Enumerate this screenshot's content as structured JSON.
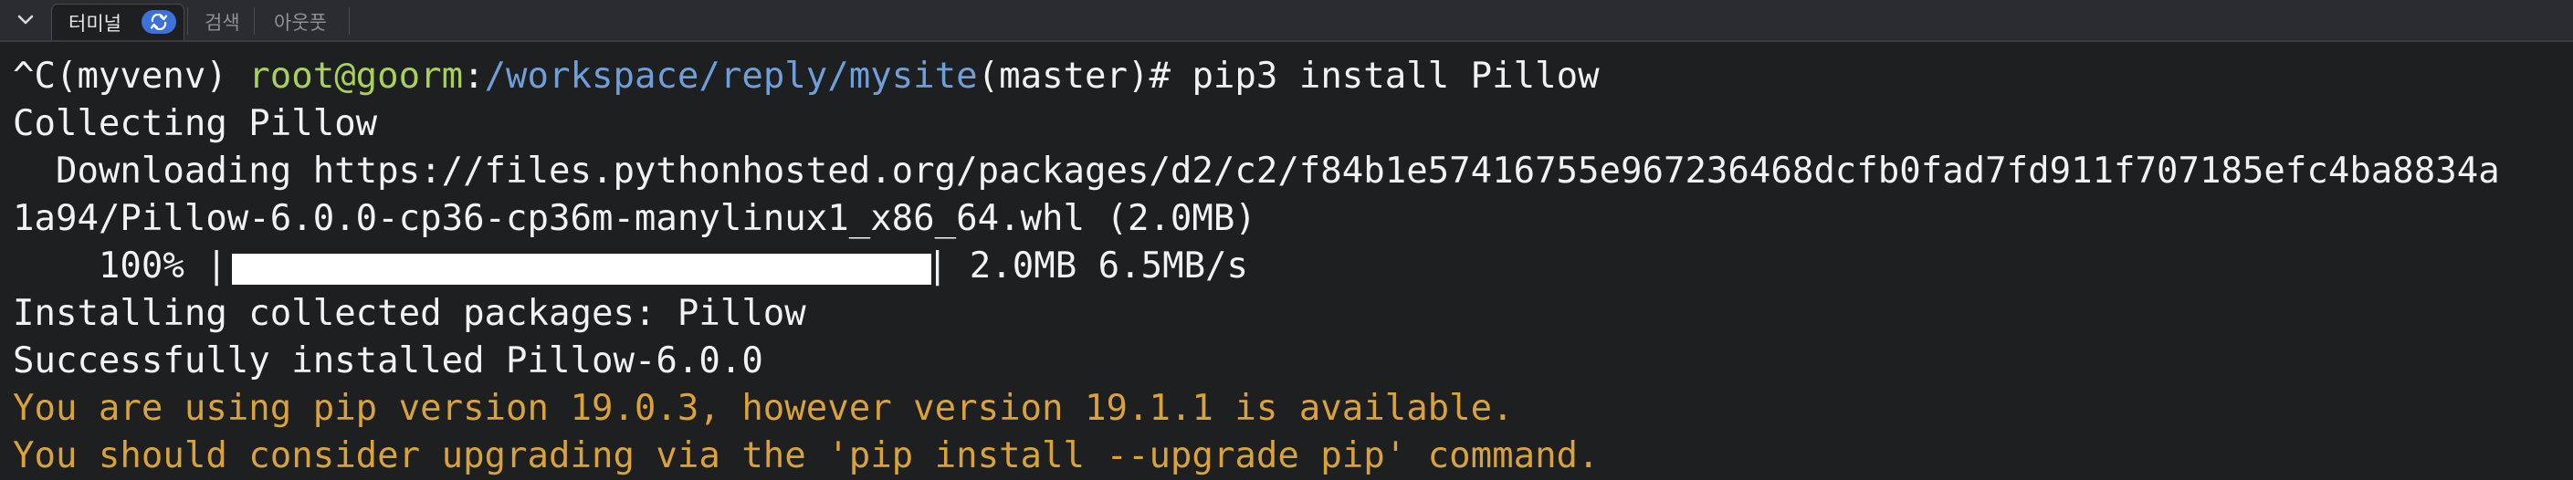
{
  "tabs": {
    "terminal": "터미널",
    "search": "검색",
    "outline": "아웃풋"
  },
  "icons": {
    "collapse": "chevron-down-icon",
    "sync": "sync-icon"
  },
  "colors": {
    "prompt_user": "#a8d05a",
    "prompt_path": "#6f9fd8",
    "warning": "#d9a23a",
    "badge": "#3d72d8"
  },
  "terminal": {
    "prompt_prefix": "^C(myvenv) ",
    "prompt_user": "root@goorm",
    "prompt_colon": ":",
    "prompt_path": "/workspace/reply/mysite",
    "prompt_suffix": "(master)# ",
    "command": "pip3 install Pillow",
    "collecting": "Collecting Pillow",
    "downloading_1": "  Downloading https://files.pythonhosted.org/packages/d2/c2/f84b1e57416755e967236468dcfb0fad7fd911f707185efc4ba8834a",
    "downloading_2": "1a94/Pillow-6.0.0-cp36-cp36m-manylinux1_x86_64.whl (2.0MB)",
    "progress_percent": "    100% |",
    "progress_value": 1.0,
    "progress_tail": "| 2.0MB 6.5MB/s",
    "installing": "Installing collected packages: Pillow",
    "success": "Successfully installed Pillow-6.0.0",
    "warning_1": "You are using pip version 19.0.3, however version 19.1.1 is available.",
    "warning_2": "You should consider upgrading via the 'pip install --upgrade pip' command."
  }
}
